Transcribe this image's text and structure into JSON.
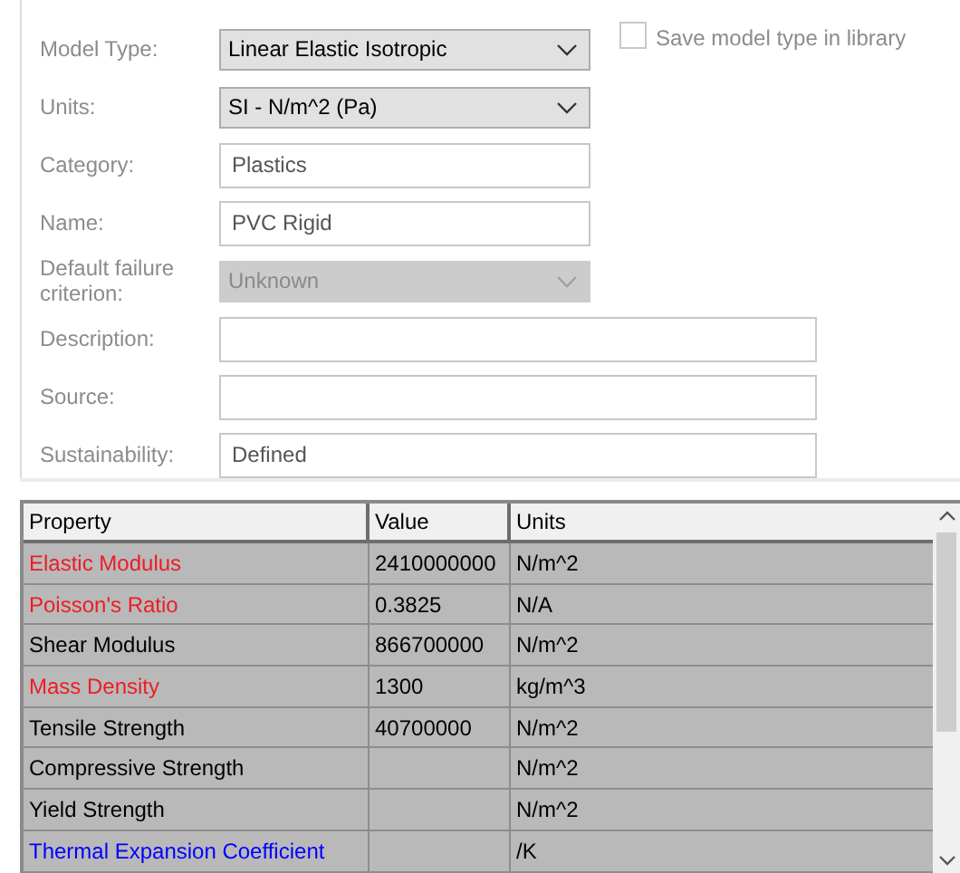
{
  "form": {
    "fields": [
      {
        "kind": "dropdown",
        "label": "Model Type:",
        "value": "Linear Elastic Isotropic",
        "disabled": false,
        "wide": false
      },
      {
        "kind": "dropdown",
        "label": "Units:",
        "value": "SI - N/m^2 (Pa)",
        "disabled": false,
        "wide": false
      },
      {
        "kind": "text",
        "label": "Category:",
        "value": "Plastics",
        "wide": false
      },
      {
        "kind": "text",
        "label": "Name:",
        "value": "PVC Rigid",
        "wide": false
      },
      {
        "kind": "dropdown",
        "label": "Default failure criterion:",
        "value": "Unknown",
        "disabled": true,
        "wide": false
      },
      {
        "kind": "text",
        "label": "Description:",
        "wide": true
      },
      {
        "kind": "text",
        "label": "Source:",
        "wide": true
      },
      {
        "kind": "text",
        "label": "Sustainability:",
        "value": "Defined",
        "wide": true
      }
    ],
    "save_checkbox": {
      "label": "Save model type in library",
      "checked": false
    }
  },
  "table": {
    "columns": [
      "Property",
      "Value",
      "Units"
    ],
    "rows": [
      {
        "property": "Elastic Modulus",
        "value": "2410000000",
        "units": "N/m^2",
        "color": "#ee1c25"
      },
      {
        "property": "Poisson's Ratio",
        "value": "0.3825",
        "units": "N/A",
        "color": "#ee1c25"
      },
      {
        "property": "Shear Modulus",
        "value": "866700000",
        "units": "N/m^2",
        "color": "#000000"
      },
      {
        "property": "Mass Density",
        "value": "1300",
        "units": "kg/m^3",
        "color": "#ee1c25"
      },
      {
        "property": "Tensile Strength",
        "value": "40700000",
        "units": "N/m^2",
        "color": "#000000"
      },
      {
        "property": "Compressive Strength",
        "units": "N/m^2",
        "color": "#000000"
      },
      {
        "property": "Yield Strength",
        "units": "N/m^2",
        "color": "#000000"
      },
      {
        "property": "Thermal Expansion Coefficient",
        "units": "/K",
        "color": "#0000ff"
      }
    ]
  }
}
